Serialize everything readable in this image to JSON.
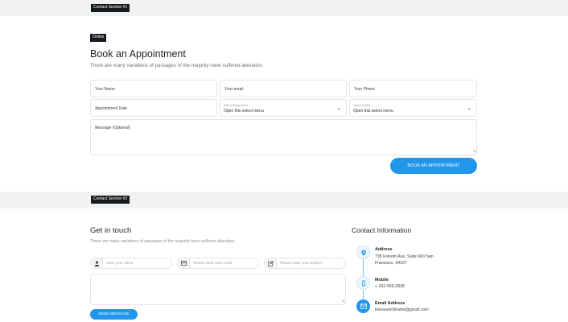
{
  "sections": {
    "first_tag": "Contact Section #1",
    "second_tag": "Contact Section #2"
  },
  "appointment": {
    "badge": "Online",
    "title": "Book an Appointment",
    "subtitle": "There are many variations of passages of the majority have suffered alteration.",
    "name_placeholder": "Your Name",
    "email_placeholder": "Your email",
    "phone_placeholder": "Your Phone",
    "date_placeholder": "Appointment Date",
    "department": {
      "label": "Select Department",
      "value": "Open this select menu"
    },
    "doctor": {
      "label": "Select Doctor",
      "value": "Open this select menu"
    },
    "message_placeholder": "Message (Optional)",
    "submit_label": "BOOK AN APPOINTMENT"
  },
  "get_in_touch": {
    "title": "Get in touch",
    "subtitle": "There are many variations of passages of the majority have suffered alteration.",
    "name_placeholder": "enter your name",
    "email_placeholder": "Please enter your email",
    "subject_placeholder": "Please enter your Subject",
    "send_label": "SEND MESSAGE"
  },
  "contact_info": {
    "title": "Contact Information",
    "address_label": "Address",
    "address_value": "795 Folsom Ave, Suite 600 San Francisco, 94107",
    "mobile_label": "Mobile",
    "mobile_value": "+ 202-555-2828",
    "email_label": "Email Address",
    "email_value": "HoosseinShams@gmail.com"
  },
  "icons": {
    "name": "user-icon",
    "email": "envelope-icon",
    "subject": "pencil-icon",
    "address": "map-pin-icon",
    "mobile": "phone-icon",
    "mail": "envelope-icon",
    "select": "chevron-down-icon",
    "accent": "#2196ea"
  }
}
